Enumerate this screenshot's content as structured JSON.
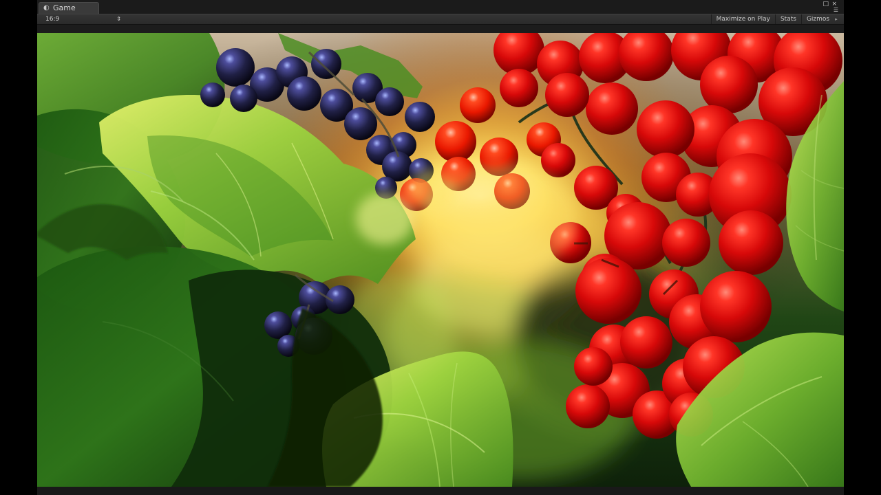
{
  "window": {
    "tab_title": "Game",
    "tab_icon": "game-icon",
    "controls": {
      "restore_icon": "restore-icon",
      "close_icon": "close-icon",
      "menu_icon": "panel-menu-icon"
    }
  },
  "toolbar": {
    "aspect_ratio": "16:9",
    "maximize_on_play": "Maximize on Play",
    "stats": "Stats",
    "gizmos": "Gizmos"
  },
  "viewport": {
    "scene": "grapes-and-red-currants-among-leaves",
    "colors": {
      "leaf_green": "#4f8f24",
      "bright_leaf": "#a6d447",
      "red_berry": "#d81010",
      "blue_berry": "#24224e",
      "sun_glow": "#ffe16b",
      "ui_dark": "#232323"
    }
  }
}
